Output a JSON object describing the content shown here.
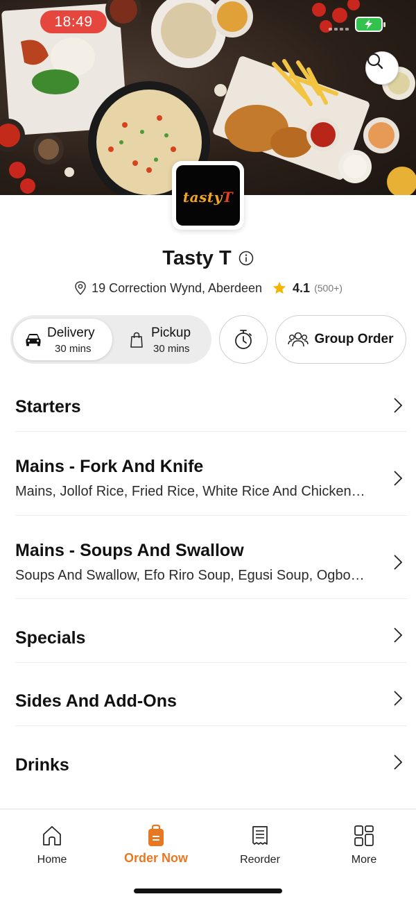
{
  "status_bar": {
    "time": "18:49"
  },
  "restaurant": {
    "name": "Tasty T",
    "logo_text_main": "tasty",
    "logo_text_accent": "T",
    "address": "19 Correction Wynd, Aberdeen",
    "rating": "4.1",
    "rating_count": "(500+)"
  },
  "order_mode": {
    "delivery_label": "Delivery",
    "delivery_time": "30 mins",
    "pickup_label": "Pickup",
    "pickup_time": "30 mins",
    "group_order_label": "Group Order"
  },
  "menu": {
    "categories": [
      {
        "title": "Starters",
        "subtitle": ""
      },
      {
        "title": "Mains - Fork And Knife",
        "subtitle": "Mains, Jollof Rice, Fried Rice, White Rice And Chicken…"
      },
      {
        "title": "Mains - Soups And Swallow",
        "subtitle": "Soups And Swallow, Efo Riro Soup, Egusi Soup, Ogbon…"
      },
      {
        "title": "Specials",
        "subtitle": ""
      },
      {
        "title": "Sides And Add-Ons",
        "subtitle": ""
      },
      {
        "title": "Drinks",
        "subtitle": ""
      }
    ]
  },
  "bottom_nav": {
    "items": [
      {
        "label": "Home",
        "icon": "home-icon"
      },
      {
        "label": "Order Now",
        "icon": "order-bag-icon"
      },
      {
        "label": "Reorder",
        "icon": "receipt-icon"
      },
      {
        "label": "More",
        "icon": "grid-icon"
      }
    ],
    "active_color": "#e87722"
  },
  "colors": {
    "accent": "#e87722",
    "status_time_bg": "#e5473f",
    "battery": "#33c24d",
    "star": "#f4b400"
  }
}
